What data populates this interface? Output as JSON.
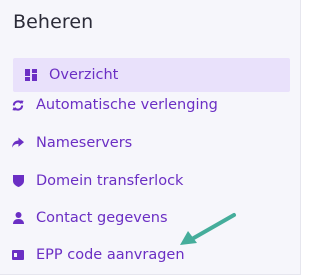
{
  "section": {
    "title": "Beheren"
  },
  "menu": {
    "items": [
      {
        "label": "Overzicht",
        "icon": "dashboard-icon",
        "active": true
      },
      {
        "label": "Automatische verlenging",
        "icon": "renew-icon",
        "active": false
      },
      {
        "label": "Nameservers",
        "icon": "share-arrow-icon",
        "active": false
      },
      {
        "label": "Domein transferlock",
        "icon": "shield-icon",
        "active": false
      },
      {
        "label": "Contact gegevens",
        "icon": "user-icon",
        "active": false
      },
      {
        "label": "EPP code aanvragen",
        "icon": "id-card-icon",
        "active": false
      }
    ]
  },
  "colors": {
    "accent": "#6b2fc4",
    "active_bg": "#e9e1fb",
    "panel_bg": "#f6f6fb",
    "annotation_arrow": "#45ad9b"
  }
}
